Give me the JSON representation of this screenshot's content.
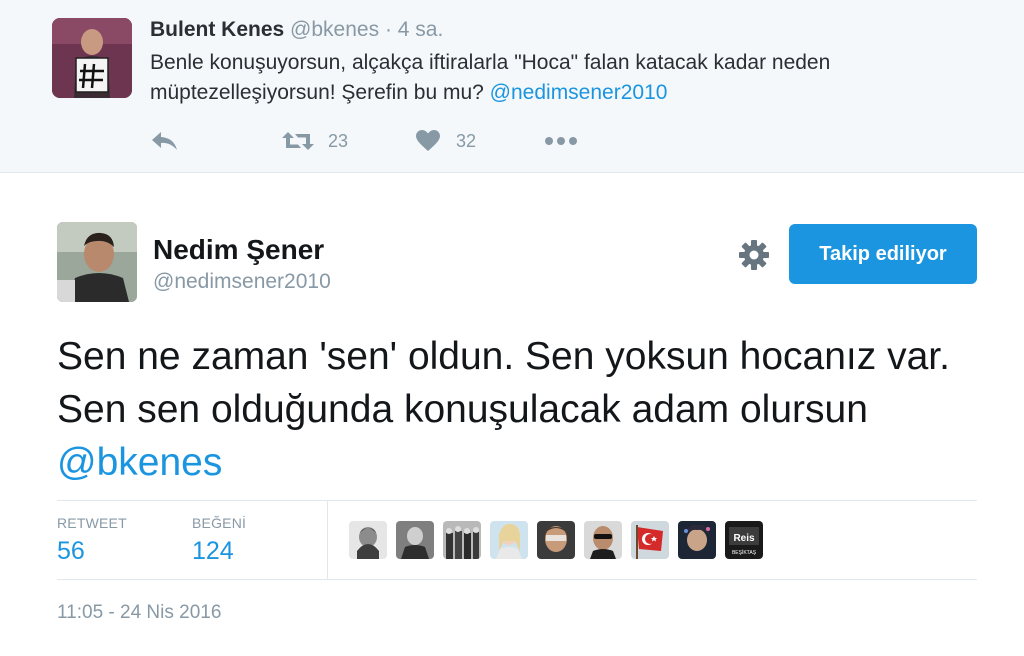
{
  "parent_tweet": {
    "name": "Bulent Kenes",
    "handle": "@bkenes",
    "separator": "·",
    "time": "4 sa.",
    "text_before": "Benle konuşuyorsun, alçakça iftiralarla \"Hoca\" falan katacak kadar neden müptezelleşiyorsun! Şerefin bu mu? ",
    "mention": "@nedimsener2010",
    "retweets": "23",
    "likes": "32",
    "icons": {
      "reply": "reply-icon",
      "retweet": "retweet-icon",
      "like": "heart-icon",
      "more": "more-icon"
    }
  },
  "main_tweet": {
    "name": "Nedim Şener",
    "handle": "@nedimsener2010",
    "follow_button": "Takip ediliyor",
    "text_before": "Sen ne zaman 'sen' oldun. Sen yoksun hocanız var. Sen sen olduğunda konuşulacak adam olursun ",
    "mention": "@bkenes",
    "stats": {
      "retweet_label": "RETWEET",
      "retweet_count": "56",
      "like_label": "BEĞENİ",
      "like_count": "124"
    },
    "liker_count_shown": 9,
    "liker_badge_text": "BEŞİKTAŞ",
    "timestamp": "11:05 - 24 Nis 2016"
  },
  "colors": {
    "accent": "#1b95e0",
    "muted": "#8899a6",
    "parent_bg": "#f5f8fa"
  }
}
